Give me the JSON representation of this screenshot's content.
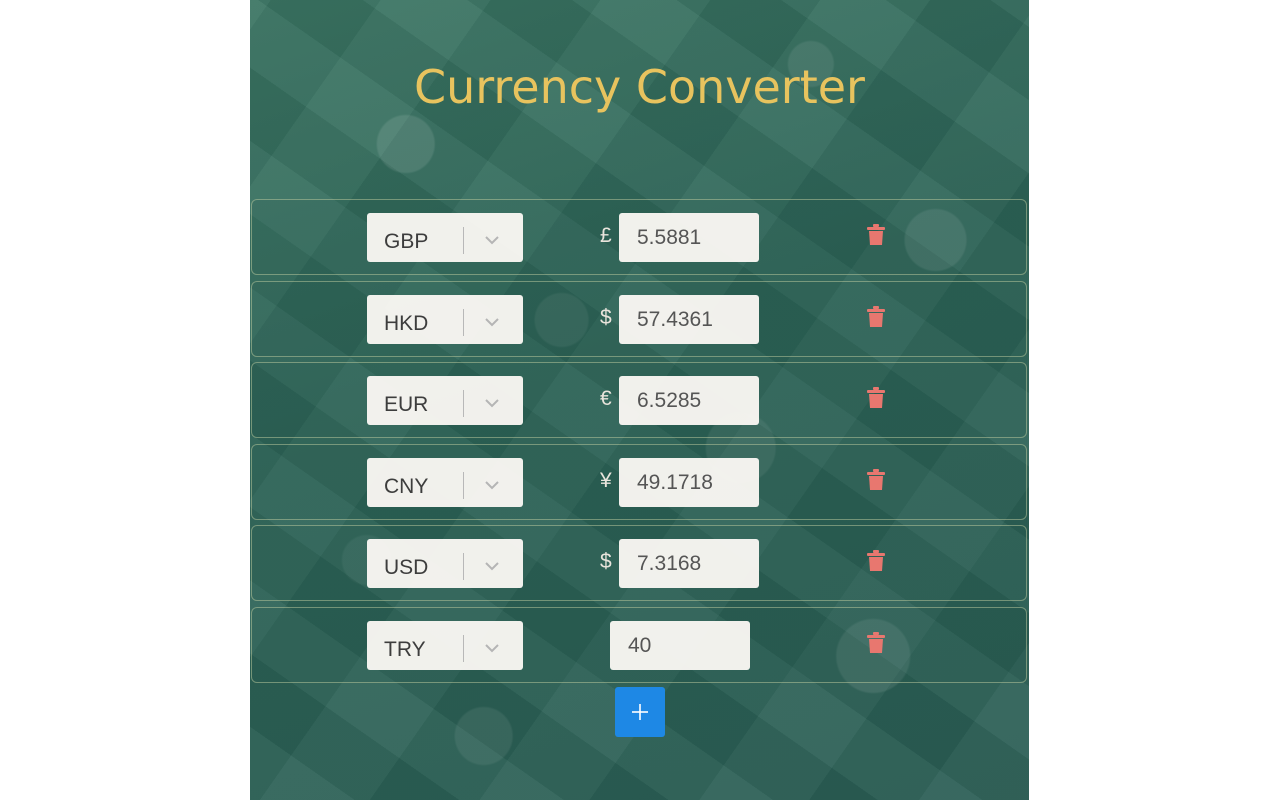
{
  "app": {
    "title": "Currency Converter"
  },
  "colors": {
    "title": "#e8c35e",
    "panel_background": "#2f6659",
    "delete_icon": "#e8776f",
    "add_button": "#1e88e5"
  },
  "rows": [
    {
      "currency": "GBP",
      "symbol": "£",
      "amount": "5.5881"
    },
    {
      "currency": "HKD",
      "symbol": "$",
      "amount": "57.4361"
    },
    {
      "currency": "EUR",
      "symbol": "€",
      "amount": "6.5285"
    },
    {
      "currency": "CNY",
      "symbol": "¥",
      "amount": "49.1718"
    },
    {
      "currency": "USD",
      "symbol": "$",
      "amount": "7.3168"
    },
    {
      "currency": "TRY",
      "symbol": "",
      "amount": "40"
    }
  ],
  "icons": {
    "dropdown": "chevron-down-icon",
    "delete": "trash-icon",
    "add": "plus-icon"
  }
}
